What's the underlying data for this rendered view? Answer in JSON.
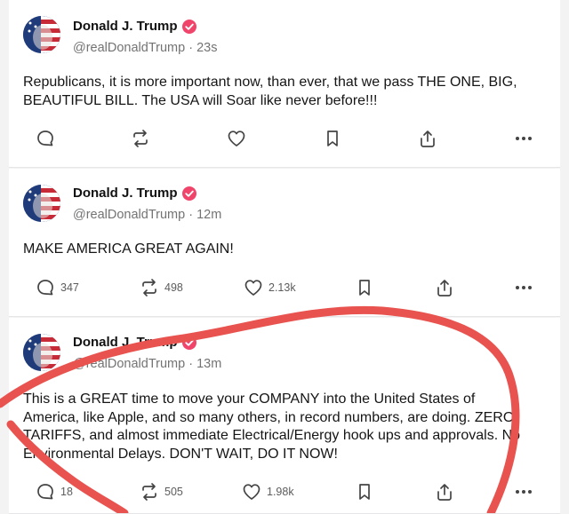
{
  "colors": {
    "verified_badge": "#f0446b",
    "scribble": "#e8534f",
    "avatar_blue": "#1f3b7a",
    "avatar_red": "#c62b37"
  },
  "posts": [
    {
      "author": "Donald J. Trump",
      "handle": "@realDonaldTrump",
      "time": "· 23s",
      "text": "Republicans, it is more important now, than ever, that we pass THE ONE, BIG, BEAUTIFUL BILL. The USA will Soar like never before!!!",
      "stats": {
        "replies": "",
        "reposts": "",
        "likes": ""
      }
    },
    {
      "author": "Donald J. Trump",
      "handle": "@realDonaldTrump",
      "time": "· 12m",
      "text": "MAKE AMERICA GREAT AGAIN!",
      "stats": {
        "replies": "347",
        "reposts": "498",
        "likes": "2.13k"
      }
    },
    {
      "author": "Donald J. Trump",
      "handle": "@realDonaldTrump",
      "time": "· 13m",
      "text": "This is a GREAT time to move your COMPANY into the United States of America, like Apple, and so many others, in record numbers, are doing. ZERO TARIFFS, and almost immediate Electrical/Energy hook ups and approvals. No Environmental Delays. DON'T WAIT, DO IT NOW!",
      "stats": {
        "replies": "18",
        "reposts": "505",
        "likes": "1.98k"
      }
    }
  ],
  "icons": {
    "reply": "comment-bubble",
    "repost": "repost-arrows",
    "like": "heart",
    "bookmark": "bookmark",
    "share": "share-up-arrow",
    "more": "ellipsis"
  }
}
